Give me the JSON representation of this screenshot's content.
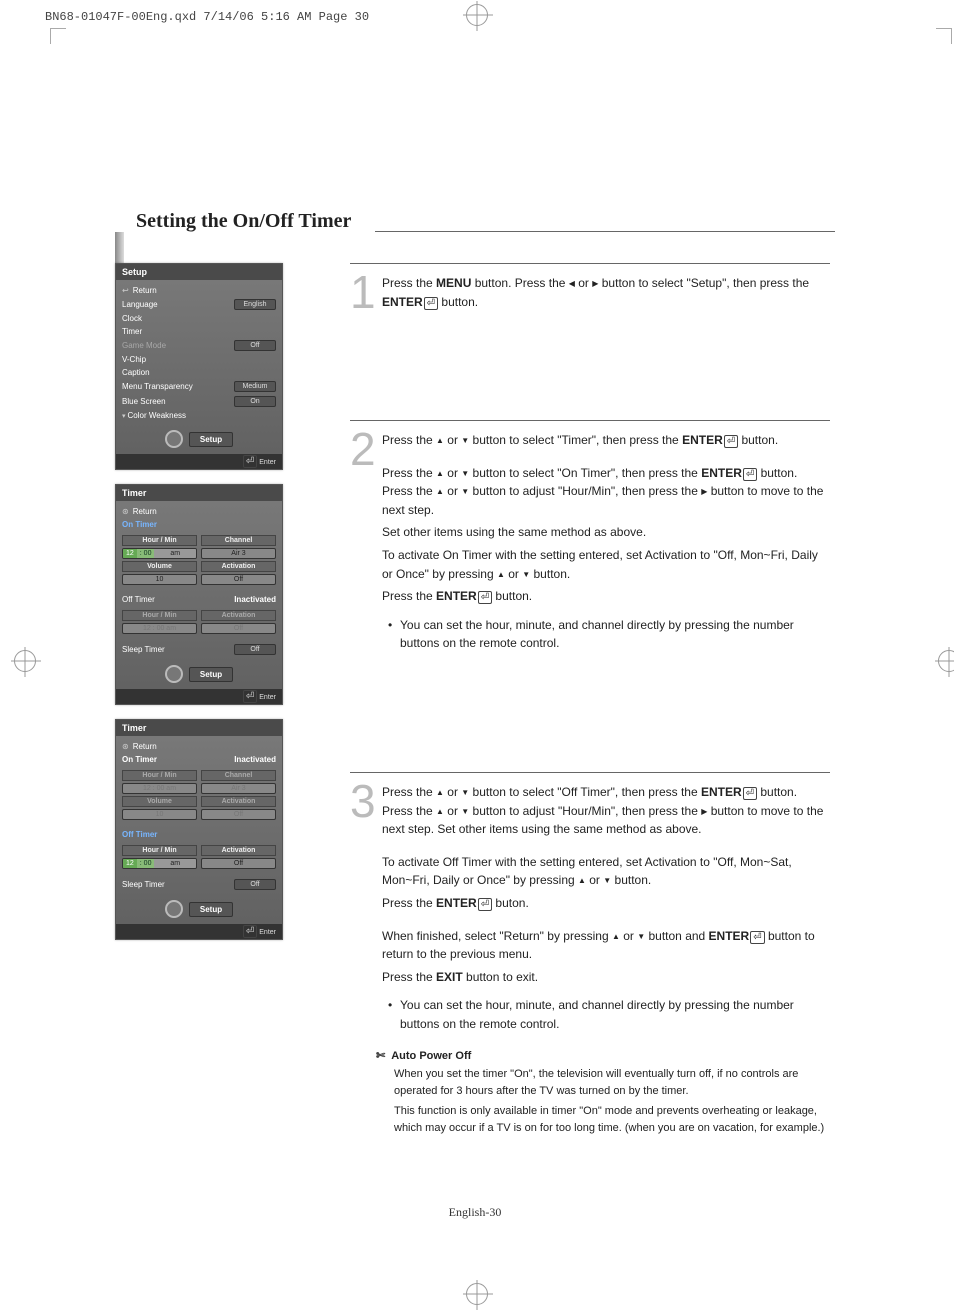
{
  "meta": {
    "qxd_line": "BN68-01047F-00Eng.qxd  7/14/06  5:16 AM  Page 30"
  },
  "title": "Setting the On/Off Timer",
  "footer": "English-30",
  "osd1": {
    "title": "Setup",
    "return": "Return",
    "rows": [
      {
        "label": "Language",
        "val": "English"
      },
      {
        "label": "Clock",
        "val": ""
      },
      {
        "label": "Timer",
        "val": ""
      },
      {
        "label": "Game Mode",
        "val": "Off",
        "muted": true
      },
      {
        "label": "V-Chip",
        "val": ""
      },
      {
        "label": "Caption",
        "val": ""
      },
      {
        "label": "Menu Transparency",
        "val": "Medium"
      },
      {
        "label": "Blue Screen",
        "val": "On"
      },
      {
        "label": "Color Weakness",
        "val": "",
        "caret": true
      }
    ],
    "foot": "Setup",
    "bottom": "Enter"
  },
  "osd2": {
    "title": "Timer",
    "return": "Return",
    "on_timer": "On Timer",
    "hdr_hour": "Hour  /  Min",
    "hdr_chan": "Channel",
    "time": "12 : 00   am",
    "chan": "Air          3",
    "hdr_vol": "Volume",
    "hdr_act": "Activation",
    "vol": "10",
    "act": "Off",
    "off_timer": "Off Timer",
    "off_state": "Inactivated",
    "off_hdr_hour": "Hour  /  Min",
    "off_hdr_act": "Activation",
    "off_time": "12 : 00   am",
    "off_act": "Off",
    "sleep": "Sleep Timer",
    "sleep_val": "Off",
    "foot": "Setup",
    "bottom": "Enter"
  },
  "osd3": {
    "title": "Timer",
    "return": "Return",
    "on_timer": "On Timer",
    "on_state": "Inactivated",
    "hdr_hour": "Hour  /  Min",
    "hdr_chan": "Channel",
    "time": "12 : 00   am",
    "chan": "Air          3",
    "hdr_vol": "Volume",
    "hdr_act": "Activation",
    "vol": "10",
    "act": "Off",
    "off_timer": "Off Timer",
    "off_hdr_hour": "Hour  /  Min",
    "off_hdr_act": "Activation",
    "off_time": "12 : 00   am",
    "off_act": "Off",
    "sleep": "Sleep Timer",
    "sleep_val": "Off",
    "foot": "Setup",
    "bottom": "Enter"
  },
  "step1": {
    "num": "1",
    "t1a": "Press the ",
    "t1b": "MENU",
    "t1c": " button. Press the ",
    "t1d": " or ",
    "t1e": " button to select \"Setup\", then press the ",
    "t1f": "ENTER",
    "t1g": " button."
  },
  "step2": {
    "num": "2",
    "p1a": "Press the ",
    "p1b": " or ",
    "p1c": " button to select \"Timer\", then press the ",
    "p1d": "ENTER",
    "p1e": " button.",
    "p2a": "Press the ",
    "p2b": " or ",
    "p2c": " button to select \"On Timer\", then press the ",
    "p2d": "ENTER",
    "p2e": " button. Press the ",
    "p2f": " or ",
    "p2g": " button to adjust \"Hour/Min\", then press the ",
    "p2h": " button to move to the next step.",
    "p3": "Set other items using the same method as above.",
    "p4a": "To activate On Timer with the setting entered, set Activation to \"Off, Mon~Fri, Daily or Once\" by pressing ",
    "p4b": " or ",
    "p4c": " button.",
    "p5a": "Press the ",
    "p5b": "ENTER",
    "p5c": " button.",
    "bullet": "You can set the hour, minute, and channel directly by pressing the number buttons on the remote control."
  },
  "step3": {
    "num": "3",
    "p1a": "Press the ",
    "p1b": " or ",
    "p1c": " button to select \"Off Timer\", then press the ",
    "p1d": "ENTER",
    "p1e": " button. Press the ",
    "p1f": " or ",
    "p1g": " button to adjust \"Hour/Min\", then press the ",
    "p1h": " button to move to the next step. Set other items using the same method as above.",
    "p2a": "To activate Off Timer with the setting entered, set Activation to \"Off, Mon~Sat, Mon~Fri, Daily or Once\"  by pressing ",
    "p2b": " or ",
    "p2c": " button.",
    "p3a": "Press the ",
    "p3b": "ENTER",
    "p3c": " buton.",
    "p4a": "When finished, select \"Return\" by pressing ",
    "p4b": " or ",
    "p4c": " button and ",
    "p4d": "ENTER",
    "p4e": " button to return to the previous menu.",
    "p5a": "Press the ",
    "p5b": "EXIT",
    "p5c": " button to exit.",
    "bullet": "You can set the hour, minute, and channel directly by pressing the number buttons on the remote control."
  },
  "note": {
    "hdr": "Auto Power Off",
    "l1": "When you set the timer \"On\", the television will eventually turn off, if no controls are operated for 3 hours after the TV was turned on by the timer.",
    "l2": "This function is only available in timer \"On\" mode and prevents overheating or leakage, which may occur if a TV is on for too long time. (when you are on vacation, for example.)"
  }
}
